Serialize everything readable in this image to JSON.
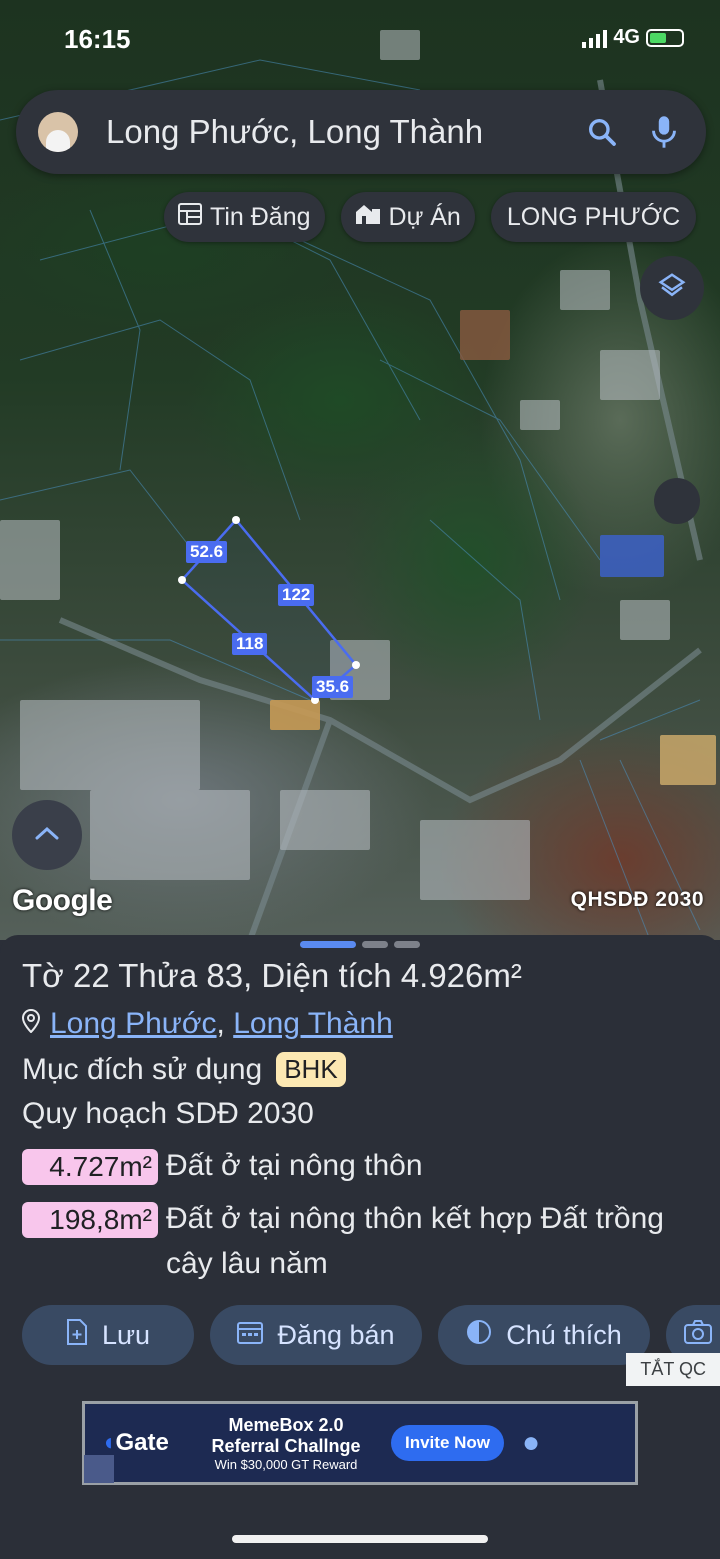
{
  "status": {
    "time": "16:15",
    "network": "4G"
  },
  "search": {
    "query": "Long Phước, Long Thành"
  },
  "chips": [
    {
      "label": "Tin Đăng",
      "icon": "list-icon"
    },
    {
      "label": "Dự Án",
      "icon": "building-icon"
    },
    {
      "label": "LONG PHƯỚC"
    }
  ],
  "map": {
    "attribution": "Google",
    "overlay_label": "QHSDĐ 2030",
    "plot_edges": [
      "52.6",
      "122",
      "118",
      "35.6"
    ]
  },
  "parcel": {
    "title": "Tờ 22 Thửa 83, Diện tích 4.926m²",
    "ward": "Long Phước",
    "district": "Long Thành",
    "purpose_label": "Mục đích sử dụng",
    "purpose_code": "BHK",
    "plan_label": "Quy hoạch SDĐ 2030",
    "zones": [
      {
        "area": "4.727m²",
        "desc": "Đất ở tại nông thôn"
      },
      {
        "area": "198,8m²",
        "desc": "Đất ở tại nông thôn kết hợp Đất trồng cây lâu năm"
      }
    ]
  },
  "actions": [
    {
      "label": "Lưu",
      "icon": "save-icon"
    },
    {
      "label": "Đăng bán",
      "icon": "calendar-icon"
    },
    {
      "label": "Chú thích",
      "icon": "contrast-icon"
    }
  ],
  "ad": {
    "close_label": "TẮT QC",
    "brand": "Gate",
    "line1": "MemeBox 2.0",
    "line2": "Referral Challnge",
    "line3": "Win $30,000 GT Reward",
    "cta": "Invite Now"
  },
  "colors": {
    "accent": "#8ab4f8",
    "plot_line": "#4a6cf0",
    "sheet_bg": "#2b2f38"
  }
}
